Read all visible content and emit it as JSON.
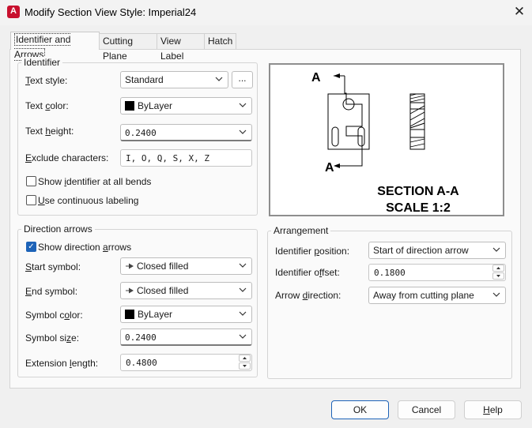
{
  "window": {
    "title": "Modify Section View Style: Imperial24",
    "close_glyph": "✕",
    "app_icon_letter": "A"
  },
  "tabs": [
    {
      "label": "Identifier and Arrows",
      "active": true
    },
    {
      "label": "Cutting Plane",
      "active": false
    },
    {
      "label": "View Label",
      "active": false
    },
    {
      "label": "Hatch",
      "active": false
    }
  ],
  "identifier": {
    "group_title": "Identifier",
    "text_style": {
      "pre": "T",
      "rest": "ext style:",
      "value": "Standard"
    },
    "browse_label": "...",
    "text_color": {
      "pre": "Text ",
      "u": "c",
      "rest": "olor:",
      "value": "ByLayer"
    },
    "text_height": {
      "pre": "Text ",
      "u": "h",
      "rest": "eight:",
      "value": "0.2400"
    },
    "exclude": {
      "pre": "E",
      "rest": "xclude characters:",
      "value": "I, O, Q, S, X, Z"
    },
    "show_all_bends": {
      "pre": "Show ",
      "u": "i",
      "rest": "dentifier at all bends",
      "checked": false
    },
    "continuous": {
      "pre": "",
      "u": "U",
      "rest": "se continuous labeling",
      "checked": false
    }
  },
  "direction_arrows": {
    "group_title": "Direction arrows",
    "show": {
      "pre": "Show direction ",
      "u": "a",
      "rest": "rrows",
      "checked": true
    },
    "start_symbol": {
      "pre": "",
      "u": "S",
      "rest": "tart symbol:",
      "value": "Closed filled"
    },
    "end_symbol": {
      "pre": "",
      "u": "E",
      "rest": "nd symbol:",
      "value": "Closed filled"
    },
    "symbol_color": {
      "pre": "Symbol c",
      "u": "o",
      "rest": "lor:",
      "value": "ByLayer"
    },
    "symbol_size": {
      "pre": "Symbol si",
      "u": "z",
      "rest": "e:",
      "value": "0.2400"
    },
    "extension_length": {
      "pre": "Extension ",
      "u": "l",
      "rest": "ength:",
      "value": "0.4800"
    }
  },
  "arrangement": {
    "group_title": "Arrangement",
    "identifier_position": {
      "pre": "Identifier ",
      "u": "p",
      "rest": "osition:",
      "value": "Start of direction arrow"
    },
    "identifier_offset": {
      "pre": "Identifier o",
      "u": "f",
      "rest": "fset:",
      "value": "0.1800"
    },
    "arrow_direction": {
      "pre": "Arrow ",
      "u": "d",
      "rest": "irection:",
      "value": "Away from cutting plane"
    }
  },
  "preview": {
    "label_top": "A",
    "label_bottom": "A",
    "section_title": "SECTION A-A",
    "scale": "SCALE 1:2"
  },
  "buttons": {
    "ok": "OK",
    "cancel": "Cancel",
    "help": {
      "pre": "",
      "u": "H",
      "rest": "elp"
    }
  }
}
